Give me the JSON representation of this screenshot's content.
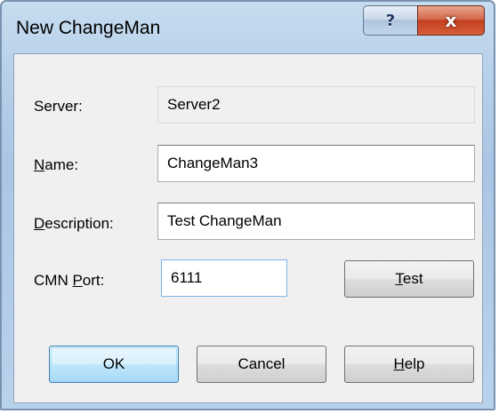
{
  "window": {
    "title": "New ChangeMan",
    "help_glyph": "?",
    "close_glyph": "x"
  },
  "form": {
    "server_label": "Server:",
    "server_value": "Server2",
    "name_label_accel": "N",
    "name_label_rest": "ame:",
    "name_value": "ChangeMan3",
    "description_label_accel": "D",
    "description_label_rest": "escription:",
    "description_value": "Test ChangeMan",
    "port_label_pre": "CMN ",
    "port_label_accel": "P",
    "port_label_rest": "ort:",
    "port_value": "6111"
  },
  "buttons": {
    "test_accel": "T",
    "test_rest": "est",
    "ok": "OK",
    "cancel": "Cancel",
    "help_accel": "H",
    "help_rest": "elp"
  }
}
